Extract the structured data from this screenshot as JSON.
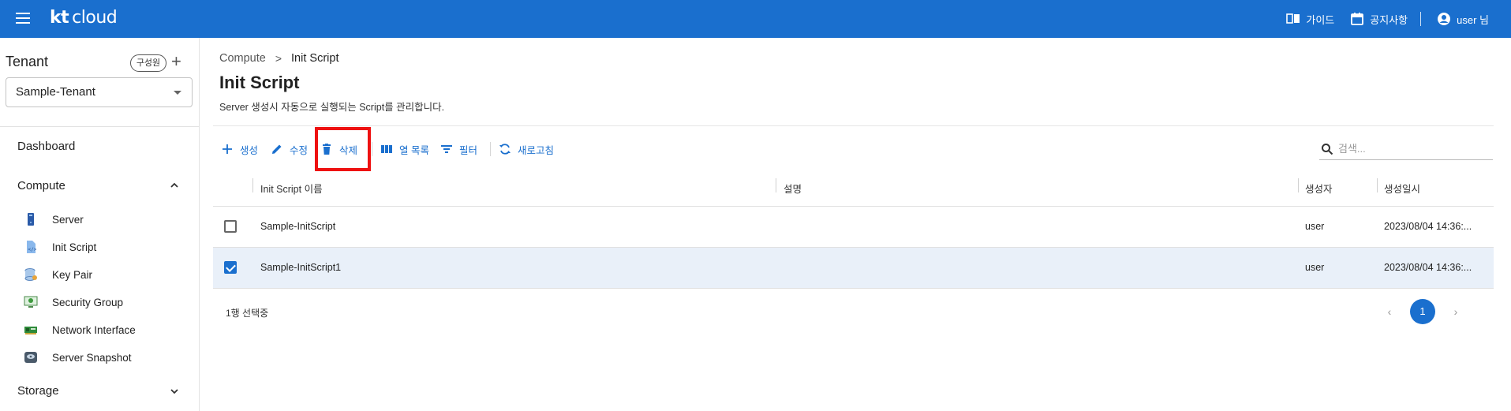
{
  "brand": {
    "logo_main": "kt",
    "logo_sub": "cloud"
  },
  "topbar": {
    "guide": "가이드",
    "notice": "공지사항",
    "user": "user 님"
  },
  "sidebar": {
    "tenant_title": "Tenant",
    "members_button": "구성원",
    "add_button": "+",
    "tenant_selected": "Sample-Tenant",
    "dashboard": "Dashboard",
    "compute_section": "Compute",
    "compute_items": [
      {
        "label": "Server",
        "icon": "server-icon"
      },
      {
        "label": "Init Script",
        "icon": "script-file-icon"
      },
      {
        "label": "Key Pair",
        "icon": "key-pair-icon"
      },
      {
        "label": "Security Group",
        "icon": "security-group-icon"
      },
      {
        "label": "Network Interface",
        "icon": "network-card-icon"
      },
      {
        "label": "Server Snapshot",
        "icon": "snapshot-disk-icon"
      }
    ],
    "storage_section": "Storage"
  },
  "breadcrumb": {
    "parent": "Compute",
    "separator": ">",
    "current": "Init Script"
  },
  "page": {
    "title": "Init Script",
    "description": "Server 생성시 자동으로 실행되는 Script를 관리합니다."
  },
  "toolbar": {
    "create": "생성",
    "edit": "수정",
    "delete": "삭제",
    "columns": "열 목록",
    "filter": "필터",
    "refresh": "새로고침"
  },
  "search": {
    "placeholder": "검색..."
  },
  "table": {
    "headers": {
      "name": "Init Script 이름",
      "description": "설명",
      "creator": "생성자",
      "created_at": "생성일시"
    },
    "rows": [
      {
        "name": "Sample-InitScript",
        "description": "",
        "creator": "user",
        "created_at": "2023/08/04 14:36:...",
        "checked": false
      },
      {
        "name": "Sample-InitScript1",
        "description": "",
        "creator": "user",
        "created_at": "2023/08/04 14:36:...",
        "checked": true
      }
    ]
  },
  "footer": {
    "selected_count": "1행 선택중",
    "current_page": "1",
    "prev": "‹",
    "next": "›"
  },
  "colors": {
    "primary": "#1a6fce",
    "highlight": "#ee1111",
    "selected_row": "#e9f0f9"
  }
}
